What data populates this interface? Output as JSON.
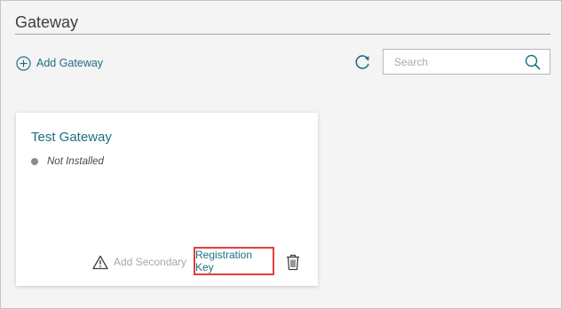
{
  "header": {
    "title": "Gateway"
  },
  "toolbar": {
    "add_gateway_label": "Add Gateway",
    "refresh_icon": "refresh-icon",
    "search_placeholder": "Search",
    "search_value": ""
  },
  "gateways": [
    {
      "name": "Test Gateway",
      "status": "Not Installed",
      "status_color": "#8c8c8c",
      "add_secondary_label": "Add Secondary",
      "registration_key_label": "Registration Key",
      "highlight_color": "#e23d3d"
    }
  ],
  "colors": {
    "accent": "#1f6f86",
    "disabled": "#a8a8a8",
    "background": "#f4f4f4"
  }
}
